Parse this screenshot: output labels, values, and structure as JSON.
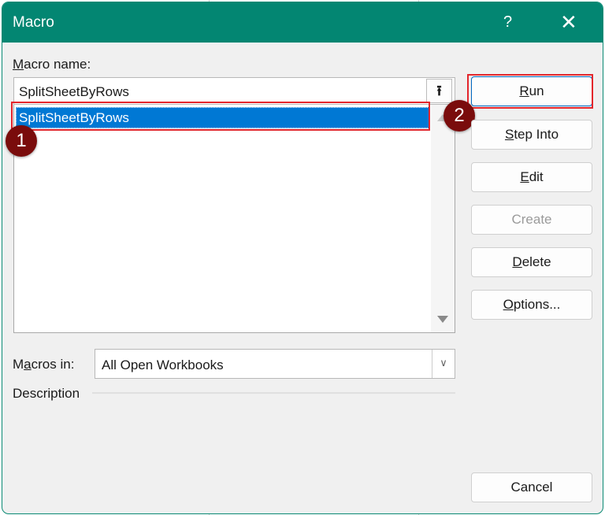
{
  "window": {
    "title": "Macro",
    "help_icon": "?",
    "close_icon": "✕"
  },
  "macro_name": {
    "label_accel": "M",
    "label_rest": "acro name:",
    "value": "SplitSheetByRows",
    "upload_icon": "⭱"
  },
  "macro_list": {
    "items": [
      "SplitSheetByRows"
    ],
    "selected": "SplitSheetByRows"
  },
  "buttons": {
    "run": {
      "accel": "R",
      "rest": "un"
    },
    "step_into": {
      "accel": "S",
      "rest": "tep Into"
    },
    "edit": {
      "accel": "E",
      "rest": "dit"
    },
    "create": {
      "label": "Create"
    },
    "delete": {
      "accel": "D",
      "rest": "elete"
    },
    "options": {
      "accel": "O",
      "rest": "ptions..."
    },
    "cancel": {
      "label": "Cancel"
    }
  },
  "macros_in": {
    "label_pre": "M",
    "label_accel": "a",
    "label_rest": "cros in:",
    "value": "All Open Workbooks"
  },
  "description": {
    "label": "Description"
  },
  "annotations": {
    "step1": "1",
    "step2": "2"
  },
  "colors": {
    "titlebar": "#038672",
    "selection": "#0078d4",
    "highlight": "#e3262c",
    "badge": "#7a0c0c"
  }
}
